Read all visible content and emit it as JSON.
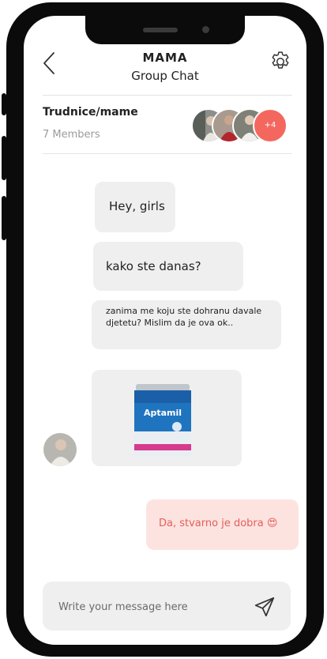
{
  "header": {
    "title": "MAMA",
    "subtitle": "Group Chat"
  },
  "group": {
    "name": "Trudnice/mame",
    "members": "7 Members",
    "more_count": "+4"
  },
  "messages": [
    {
      "text": "Hey, girls"
    },
    {
      "text": "kako ste danas?"
    },
    {
      "text": "zanima me koju ste dohranu davale djetetu? Mislim da je ova ok.."
    },
    {
      "type": "image",
      "brand": "Aptamil"
    }
  ],
  "sent_message": {
    "text": "Da, stvarno je dobra 😍"
  },
  "composer": {
    "placeholder": "Write your message here"
  },
  "colors": {
    "accent": "#f4675e",
    "sent_bubble": "#fde3e0",
    "sent_text": "#e25f5a",
    "received_bubble": "#efefef"
  },
  "icons": {
    "back": "chevron-left-icon",
    "settings": "gear-icon",
    "send": "send-icon"
  }
}
